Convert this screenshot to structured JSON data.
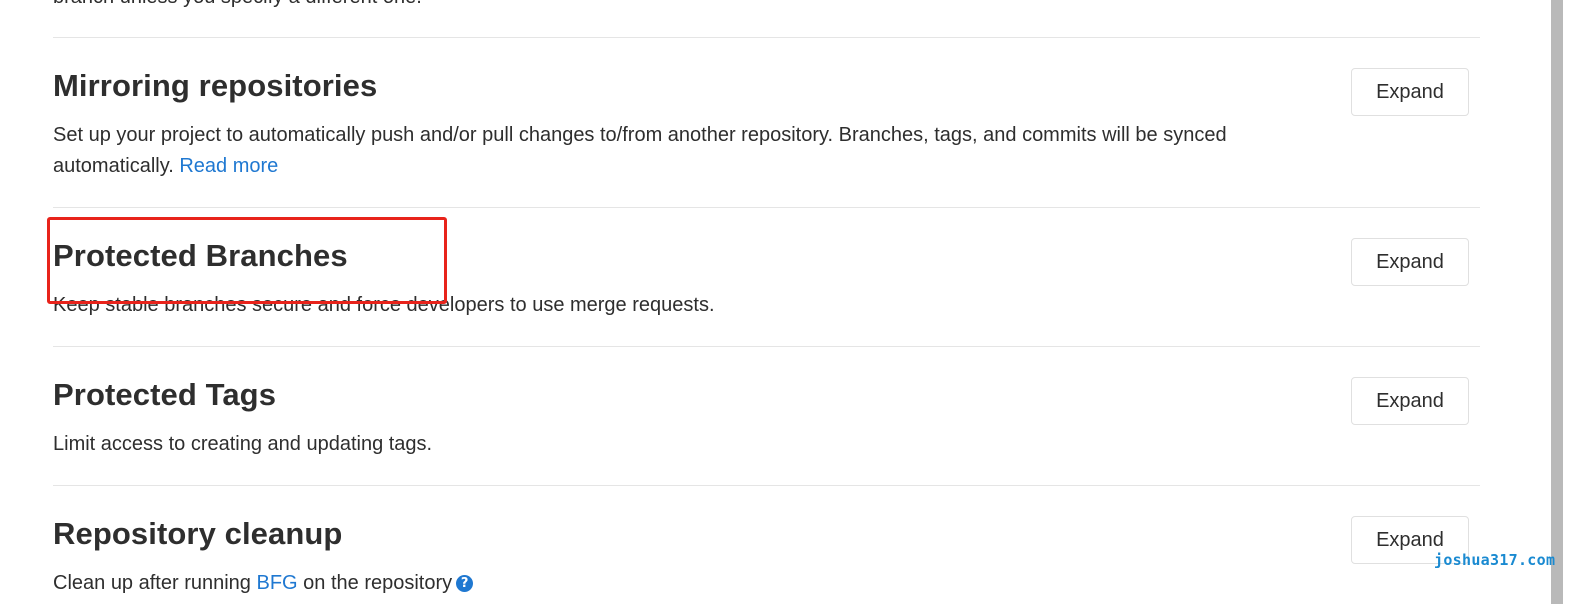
{
  "top_partial_text": "branch unless you specify a different one.",
  "sections": [
    {
      "title": "Mirroring repositories",
      "description": "Set up your project to automatically push and/or pull changes to/from another repository. Branches, tags, and commits will be synced automatically.",
      "link": "Read more",
      "button": "Expand"
    },
    {
      "title": "Protected Branches",
      "description": "Keep stable branches secure and force developers to use merge requests.",
      "button": "Expand"
    },
    {
      "title": "Protected Tags",
      "description": "Limit access to creating and updating tags.",
      "button": "Expand"
    },
    {
      "title": "Repository cleanup",
      "description_before": "Clean up after running",
      "link": "BFG",
      "description_after": "on the repository",
      "help_icon": "question-circle-icon",
      "help_glyph": "?",
      "button": "Expand"
    }
  ],
  "watermark": "joshua317.com",
  "colors": {
    "link": "#1f78d1",
    "highlight_border": "#e8231b",
    "divider": "#e5e5e5",
    "text": "#2e2e2e"
  }
}
